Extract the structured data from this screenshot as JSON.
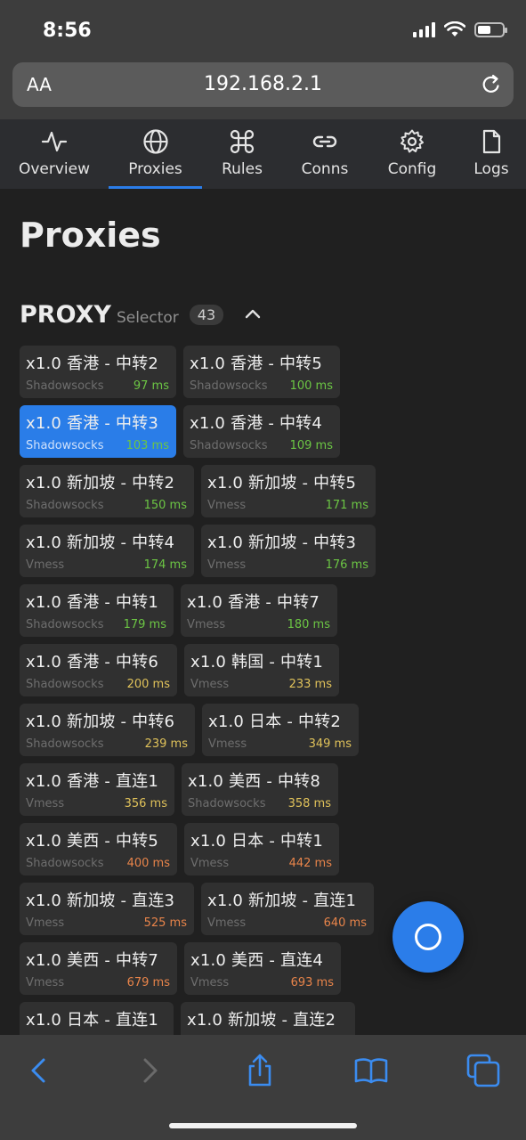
{
  "status": {
    "time": "8:56"
  },
  "browser": {
    "aa_label": "AA",
    "url": "192.168.2.1"
  },
  "nav": {
    "tabs": [
      {
        "label": "Overview",
        "icon": "activity-icon"
      },
      {
        "label": "Proxies",
        "icon": "globe-icon",
        "active": true
      },
      {
        "label": "Rules",
        "icon": "command-icon"
      },
      {
        "label": "Conns",
        "icon": "link-icon"
      },
      {
        "label": "Config",
        "icon": "gear-icon"
      },
      {
        "label": "Logs",
        "icon": "file-icon"
      }
    ]
  },
  "page": {
    "title": "Proxies"
  },
  "group": {
    "name": "PROXY",
    "type": "Selector",
    "count": "43"
  },
  "colors": {
    "accent": "#2b7de9",
    "delay_green": "#6cc644",
    "delay_yellow": "#e0c25a",
    "delay_orange": "#e8844a"
  },
  "proxies": [
    [
      {
        "name": "x1.0 香港 - 中转2",
        "type": "Shadowsocks",
        "delay": "97 ms",
        "level": "green"
      },
      {
        "name": "x1.0 香港 - 中转5",
        "type": "Shadowsocks",
        "delay": "100 ms",
        "level": "green"
      }
    ],
    [
      {
        "name": "x1.0 香港 - 中转3",
        "type": "Shadowsocks",
        "delay": "103 ms",
        "level": "green",
        "selected": true
      },
      {
        "name": "x1.0 香港 - 中转4",
        "type": "Shadowsocks",
        "delay": "109 ms",
        "level": "green"
      }
    ],
    [
      {
        "name": "x1.0 新加坡 - 中转2",
        "type": "Shadowsocks",
        "delay": "150 ms",
        "level": "green"
      },
      {
        "name": "x1.0 新加坡 - 中转5",
        "type": "Vmess",
        "delay": "171 ms",
        "level": "green"
      }
    ],
    [
      {
        "name": "x1.0 新加坡 - 中转4",
        "type": "Vmess",
        "delay": "174 ms",
        "level": "green"
      },
      {
        "name": "x1.0 新加坡 - 中转3",
        "type": "Vmess",
        "delay": "176 ms",
        "level": "green"
      }
    ],
    [
      {
        "name": "x1.0 香港 - 中转1",
        "type": "Shadowsocks",
        "delay": "179 ms",
        "level": "green"
      },
      {
        "name": "x1.0 香港 - 中转7",
        "type": "Vmess",
        "delay": "180 ms",
        "level": "green"
      }
    ],
    [
      {
        "name": "x1.0 香港 - 中转6",
        "type": "Shadowsocks",
        "delay": "200 ms",
        "level": "yellow"
      },
      {
        "name": "x1.0 韩国 - 中转1",
        "type": "Vmess",
        "delay": "233 ms",
        "level": "yellow"
      }
    ],
    [
      {
        "name": "x1.0 新加坡 - 中转6",
        "type": "Shadowsocks",
        "delay": "239 ms",
        "level": "yellow"
      },
      {
        "name": "x1.0 日本 - 中转2",
        "type": "Vmess",
        "delay": "349 ms",
        "level": "yellow"
      }
    ],
    [
      {
        "name": "x1.0 香港 - 直连1",
        "type": "Vmess",
        "delay": "356 ms",
        "level": "yellow"
      },
      {
        "name": "x1.0 美西 - 中转8",
        "type": "Shadowsocks",
        "delay": "358 ms",
        "level": "yellow"
      }
    ],
    [
      {
        "name": "x1.0 美西 - 中转5",
        "type": "Shadowsocks",
        "delay": "400 ms",
        "level": "orange"
      },
      {
        "name": "x1.0 日本 - 中转1",
        "type": "Vmess",
        "delay": "442 ms",
        "level": "orange"
      }
    ],
    [
      {
        "name": "x1.0 新加坡 - 直连3",
        "type": "Vmess",
        "delay": "525 ms",
        "level": "orange"
      },
      {
        "name": "x1.0 新加坡 - 直连1",
        "type": "Vmess",
        "delay": "640 ms",
        "level": "orange"
      }
    ],
    [
      {
        "name": "x1.0 美西 - 中转7",
        "type": "Vmess",
        "delay": "679 ms",
        "level": "orange"
      },
      {
        "name": "x1.0 美西 - 直连4",
        "type": "Vmess",
        "delay": "693 ms",
        "level": "orange"
      }
    ],
    [
      {
        "name": "x1.0 日本 - 直连1",
        "type": "",
        "delay": "",
        "level": "orange"
      },
      {
        "name": "x1.0 新加坡 - 直连2",
        "type": "",
        "delay": "",
        "level": "orange"
      }
    ]
  ]
}
